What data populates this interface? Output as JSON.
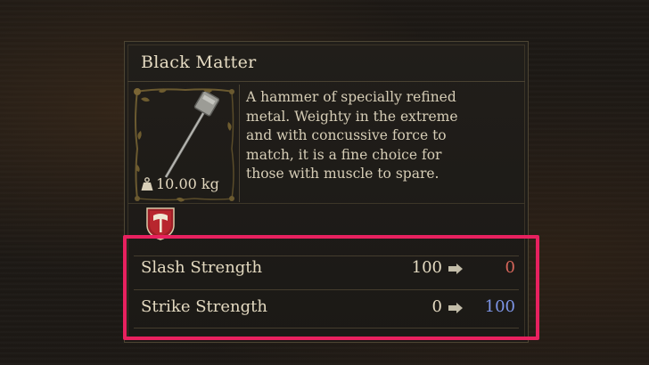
{
  "item": {
    "name": "Black Matter",
    "weight": "10.00 kg",
    "weight_icon": "weight-icon",
    "description_lines": [
      "A hammer of specially refined",
      "metal. Weighty in the extreme",
      "and with concussive force to",
      "match, it is a fine choice for",
      "those with muscle to spare."
    ],
    "category_icon": "warrior-class-badge-icon"
  },
  "stats": [
    {
      "label": "Slash Strength",
      "current": "100",
      "new": "0",
      "new_color": "#d4655a"
    },
    {
      "label": "Strike Strength",
      "current": "0",
      "new": "100",
      "new_color": "#7d95e6"
    }
  ],
  "colors": {
    "highlight": "#e8215f",
    "decrease": "#d4655a",
    "increase": "#7d95e6",
    "text": "#e3d9c0"
  }
}
